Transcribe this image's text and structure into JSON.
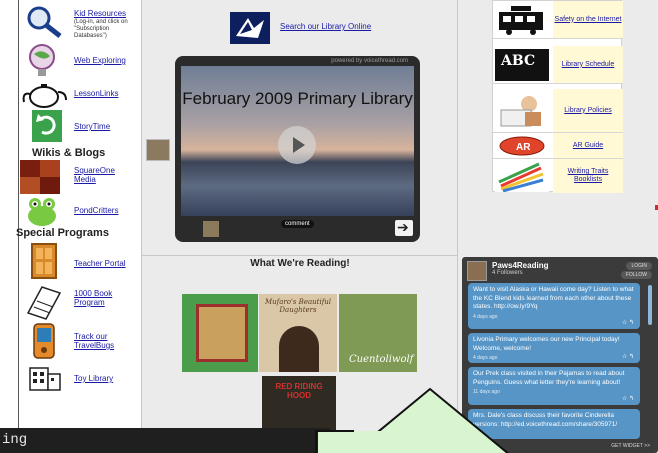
{
  "left": {
    "items": [
      {
        "label": "Kid Resources",
        "sub": "(Log-in, and click on \"Subscription Databases\")"
      },
      {
        "label": "Web Exploring"
      },
      {
        "label": "LessonLinks"
      },
      {
        "label": "StoryTime"
      },
      {
        "label": "SquareOne Media"
      },
      {
        "label": "PondCritters"
      },
      {
        "label": "Teacher Portal"
      },
      {
        "label": "1000 Book Program"
      },
      {
        "label": "Track our TravelBugs"
      },
      {
        "label": "Toy Library"
      }
    ],
    "header_wikis": "Wikis & Blogs",
    "header_special": "Special Programs"
  },
  "middle": {
    "library_link": "Search our Library Online",
    "voicethread": {
      "brand": "powered by voicethread.com",
      "title": "February 2009 Primary Library",
      "comment_label": "comment"
    },
    "reading": {
      "title": "What We're Reading!",
      "books": [
        {
          "title": ""
        },
        {
          "title": "Mufaro's Beautiful Daughters"
        },
        {
          "title": "Cuentoliwolf"
        },
        {
          "title": "RED RIDING HOOD"
        }
      ]
    }
  },
  "right": {
    "links": [
      {
        "label": "Safety on the Internet",
        "icon": "school-bus-icon"
      },
      {
        "label": "Library Schedule",
        "icon": "abc-chalkboard-icon"
      },
      {
        "label": "Library Policies",
        "icon": "reading-child-icon"
      },
      {
        "label": "AR Guide",
        "icon": "ar-badge-icon"
      },
      {
        "label": "Writing Traits Booklists",
        "icon": "pencils-icon"
      }
    ],
    "widget": {
      "name": "Paws4Reading",
      "followers": "4 Followers",
      "login": "LOGIN",
      "follow": "FOLLOW",
      "get_widget": "GET WIDGET >>",
      "tweets": [
        {
          "text": "Want to visit Alaska or Hawaii come day? Listen to what the KC Blend kids learned from each other about these states. http://ow.ly/9Yq",
          "time": "4 days ago"
        },
        {
          "text": "Livonia Primary welcomes our new Principal today! Welcome, welcome!",
          "time": "4 days ago"
        },
        {
          "text": "Our Prek class visited in their Pajamas to read about Penguins. Guess what letter they're learning about!",
          "time": "11 days ago"
        },
        {
          "text": "Mrs. Dale's class discuss their favorite Cinderella versions: http://ed.voicethread.com/share/305971/",
          "time": ""
        }
      ]
    }
  },
  "strip": {
    "text": "ing"
  }
}
